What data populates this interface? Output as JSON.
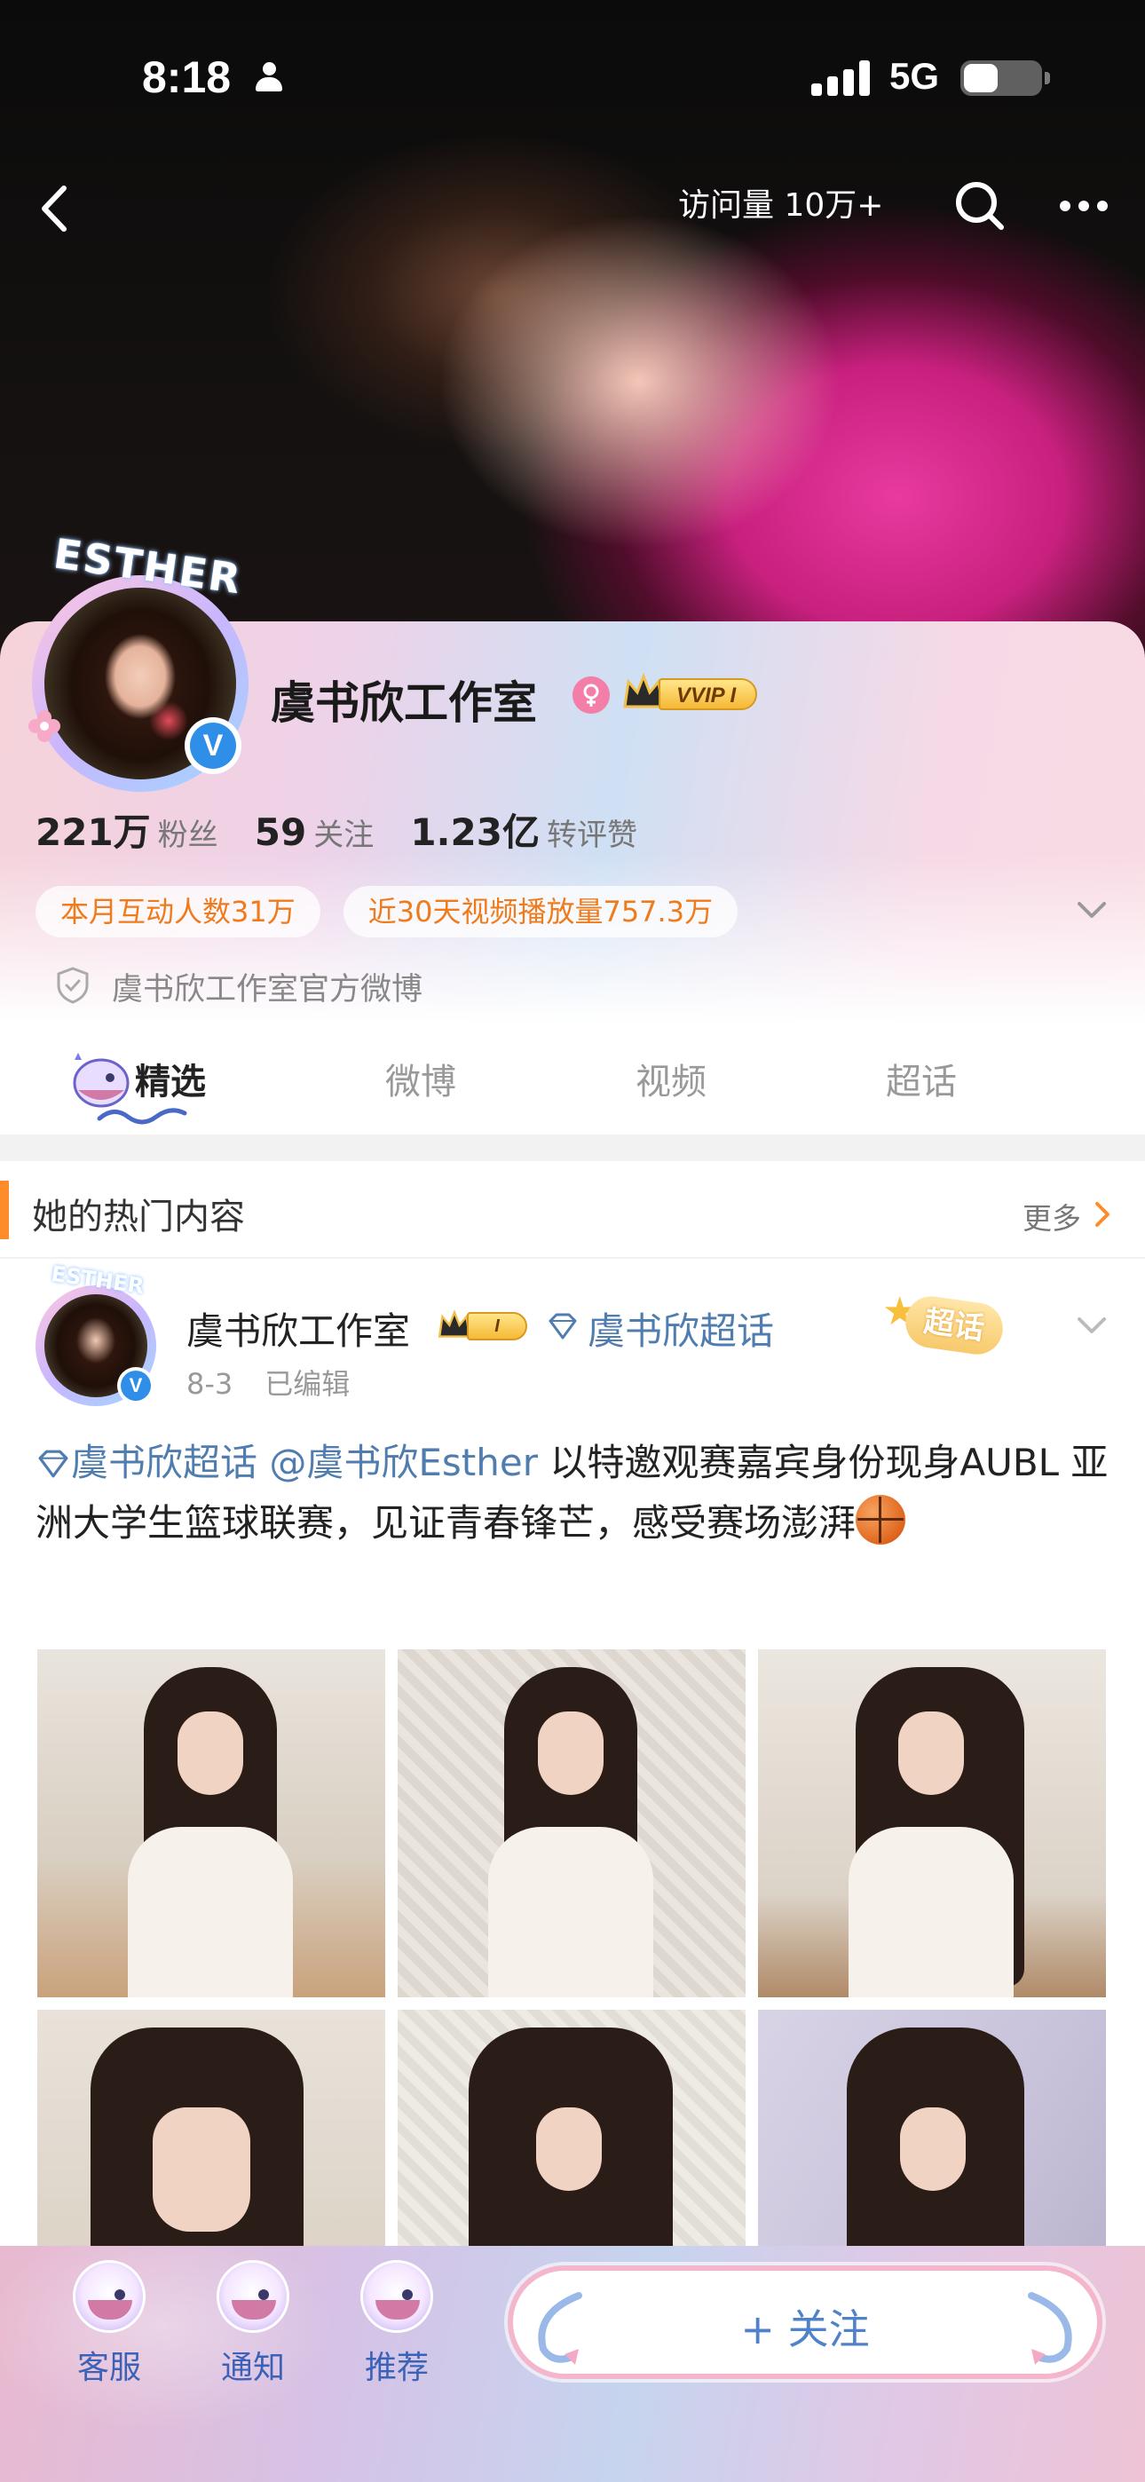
{
  "status_bar": {
    "time": "8:18",
    "network": "5G"
  },
  "top_nav": {
    "visits": "访问量 10万+"
  },
  "profile": {
    "avatar_text": "ESTHER",
    "name": "虞书欣工作室",
    "vip_label": "VVIP I",
    "stats": [
      {
        "num": "221万",
        "label": "粉丝"
      },
      {
        "num": "59",
        "label": "关注"
      },
      {
        "num": "1.23亿",
        "label": "转评赞"
      }
    ],
    "chips": [
      "本月互动人数31万",
      "近30天视频播放量757.3万"
    ],
    "official": "虞书欣工作室官方微博"
  },
  "tabs": [
    "精选",
    "微博",
    "视频",
    "超话"
  ],
  "hot": {
    "title": "她的热门内容",
    "more": "更多"
  },
  "post": {
    "avatar_text": "ESTHER",
    "name": "虞书欣工作室",
    "badge": "I",
    "topic": "虞书欣超话",
    "chaohua_badge": "超话",
    "date": "8-3",
    "edited": "已编辑",
    "text_topic": "虞书欣超话",
    "text_mention": "@虞书欣Esther",
    "text_body": " 以特邀观赛嘉宾身份现身AUBL 亚洲大学生篮球联赛，见证青春锋芒，感受赛场澎湃"
  },
  "bottom_bar": {
    "items": [
      "客服",
      "通知",
      "推荐"
    ],
    "follow": "+ 关注"
  },
  "colors": {
    "link": "#507daf",
    "chip_text": "#f07b1c",
    "hot_bar": "#ff8c2a",
    "verified": "#2f8ee8"
  }
}
